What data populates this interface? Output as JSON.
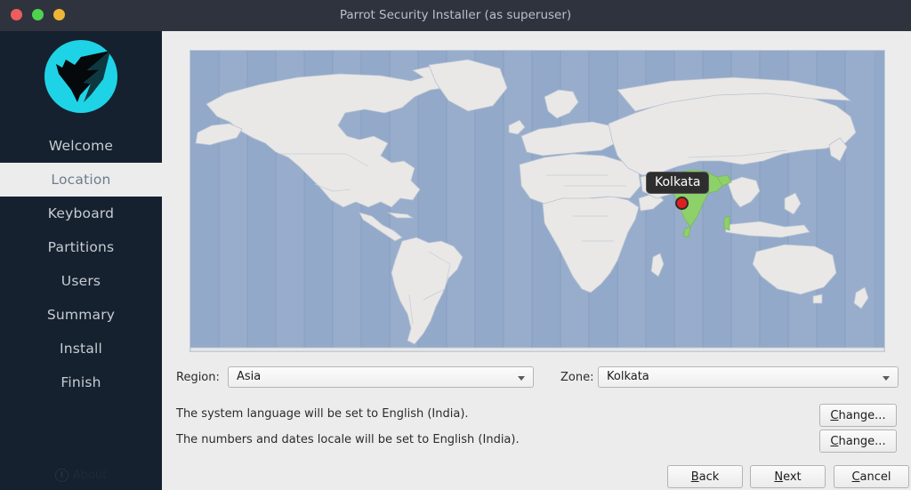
{
  "window": {
    "title": "Parrot Security Installer (as superuser)",
    "controls": [
      {
        "name": "close",
        "color": "#ed5d5d"
      },
      {
        "name": "minimize",
        "color": "#4fd24f"
      },
      {
        "name": "maximize",
        "color": "#eeb636"
      }
    ]
  },
  "sidebar": {
    "logo_label": "parrot-logo",
    "brand_color": "#1fd3e6",
    "background": "#15212f",
    "items": [
      {
        "label": "Welcome",
        "active": false
      },
      {
        "label": "Location",
        "active": true
      },
      {
        "label": "Keyboard",
        "active": false
      },
      {
        "label": "Partitions",
        "active": false
      },
      {
        "label": "Users",
        "active": false
      },
      {
        "label": "Summary",
        "active": false
      },
      {
        "label": "Install",
        "active": false
      },
      {
        "label": "Finish",
        "active": false
      }
    ],
    "about_label": "About"
  },
  "map": {
    "ocean_color": "#93a9c9",
    "land_color": "#e9e8e6",
    "highlight_color": "#8ed06a",
    "marker_color": "#e02020",
    "tooltip_label": "Kolkata"
  },
  "form": {
    "region_label": "Region:",
    "region_value": "Asia",
    "zone_label": "Zone:",
    "zone_value": "Kolkata",
    "locale_language_text": "The system language will be set to English (India).",
    "locale_numbers_text": "The numbers and dates locale will be set to English (India).",
    "change_language_button": "Change...",
    "change_numbers_button": "Change..."
  },
  "footer": {
    "back_button": "Back",
    "next_button": "Next",
    "cancel_button": "Cancel"
  }
}
